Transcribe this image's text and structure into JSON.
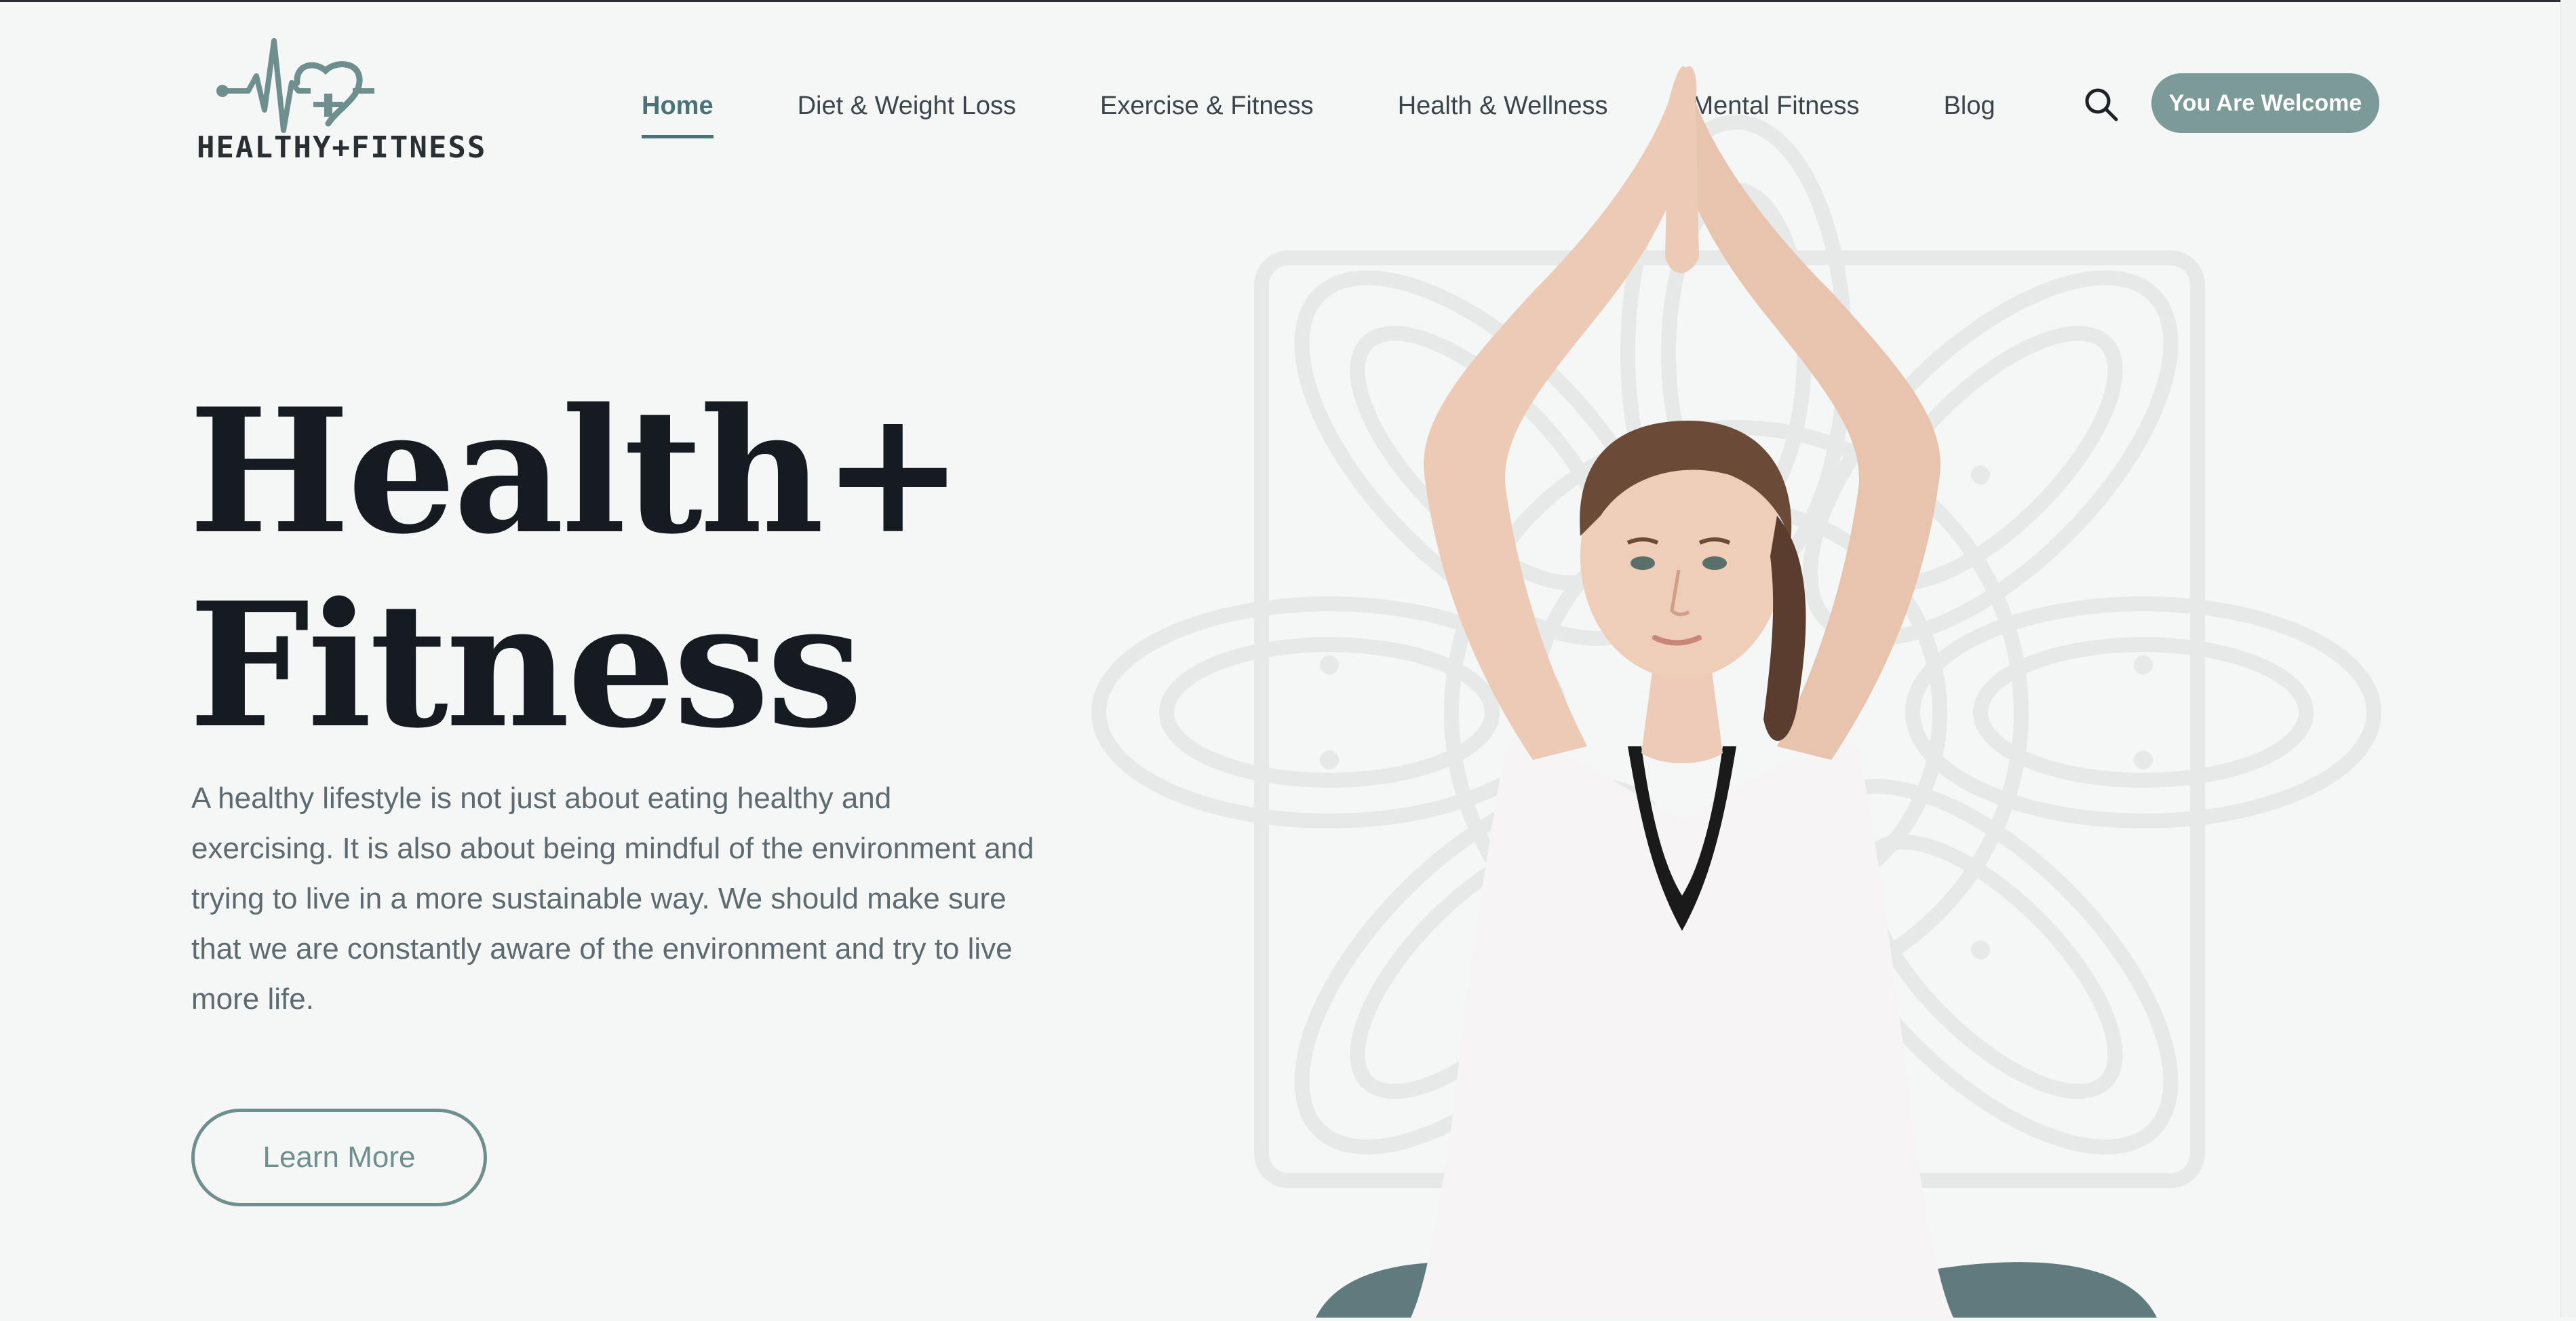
{
  "brand": {
    "logo_text": "HEALTHY+FITNESS",
    "accent_color": "#7b9a98",
    "nav_active_color": "#4a7378"
  },
  "nav": {
    "items": [
      {
        "label": "Home",
        "active": true
      },
      {
        "label": "Diet & Weight Loss",
        "active": false
      },
      {
        "label": "Exercise & Fitness",
        "active": false
      },
      {
        "label": "Health & Wellness",
        "active": false
      },
      {
        "label": "Mental Fitness",
        "active": false
      },
      {
        "label": "Blog",
        "active": false
      }
    ],
    "search_icon": "search-icon",
    "cta_label": "You Are Welcome"
  },
  "hero": {
    "title_line1": "Health+",
    "title_line2": "Fitness",
    "description": "A healthy lifestyle is not just about eating healthy and exercising. It is also about being mindful of the environment and trying to live in a more sustainable way. We should make sure that we are constantly aware of the environment and try to live more life.",
    "button_label": "Learn More"
  }
}
